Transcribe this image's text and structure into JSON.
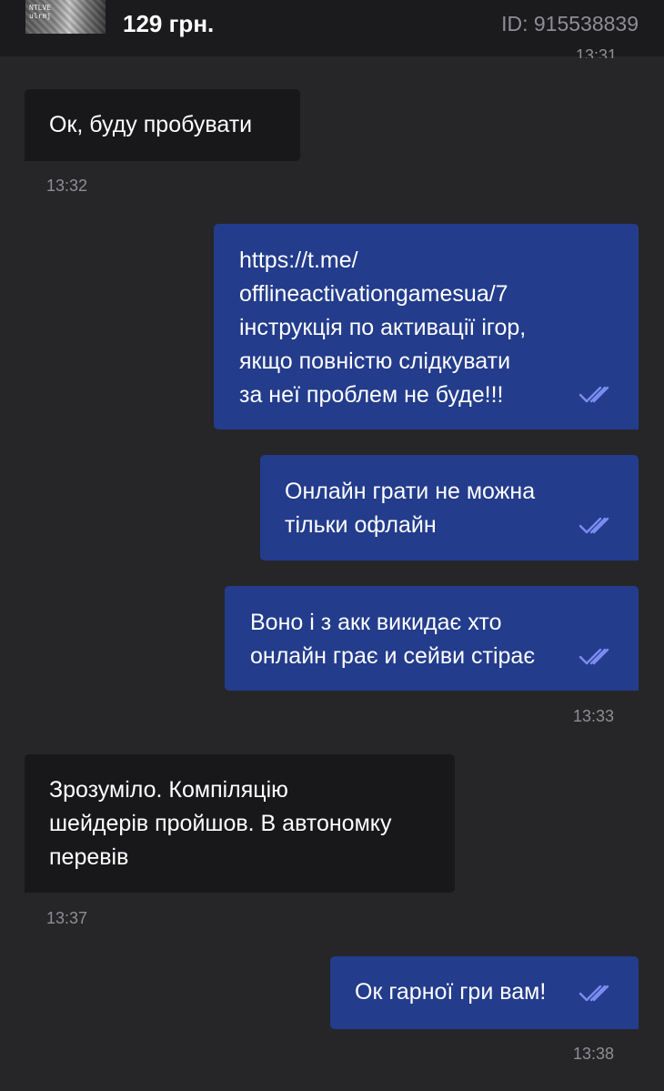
{
  "header": {
    "thumbnail_text": "NTLVE\nulrmj",
    "price": "129 грн.",
    "order_id": "ID: 915538839",
    "clipped_time": "13:31"
  },
  "messages": [
    {
      "direction": "incoming",
      "text": "Ок, буду пробувати",
      "time": "13:32"
    },
    {
      "direction": "outgoing",
      "text": "https://t.me/\nofflineactivationgamesua/7\nінструкція по активації ігор,\nякщо повністю слідкувати\nза неї проблем не буде!!!",
      "status": "read"
    },
    {
      "direction": "outgoing",
      "text": "Онлайн грати не можна\nтільки офлайн",
      "status": "read"
    },
    {
      "direction": "outgoing",
      "text": "Воно і з акк викидає хто\nонлайн грає и сейви стірає",
      "status": "read",
      "time": "13:33"
    },
    {
      "direction": "incoming",
      "text": "Зрозуміло. Компіляцію\nшейдерів пройшов. В автономку\nперевів",
      "time": "13:37"
    },
    {
      "direction": "outgoing",
      "text": "Ок гарної гри вам!",
      "status": "read",
      "time": "13:38"
    }
  ],
  "colors": {
    "background": "#262629",
    "header": "#1b1b1e",
    "incoming_bubble": "#18181a",
    "outgoing_bubble": "#233c8c",
    "read_ticks": "#7b8cf0",
    "timestamp": "#8e8e93"
  },
  "icons": {
    "read_status": "double-check-icon"
  }
}
